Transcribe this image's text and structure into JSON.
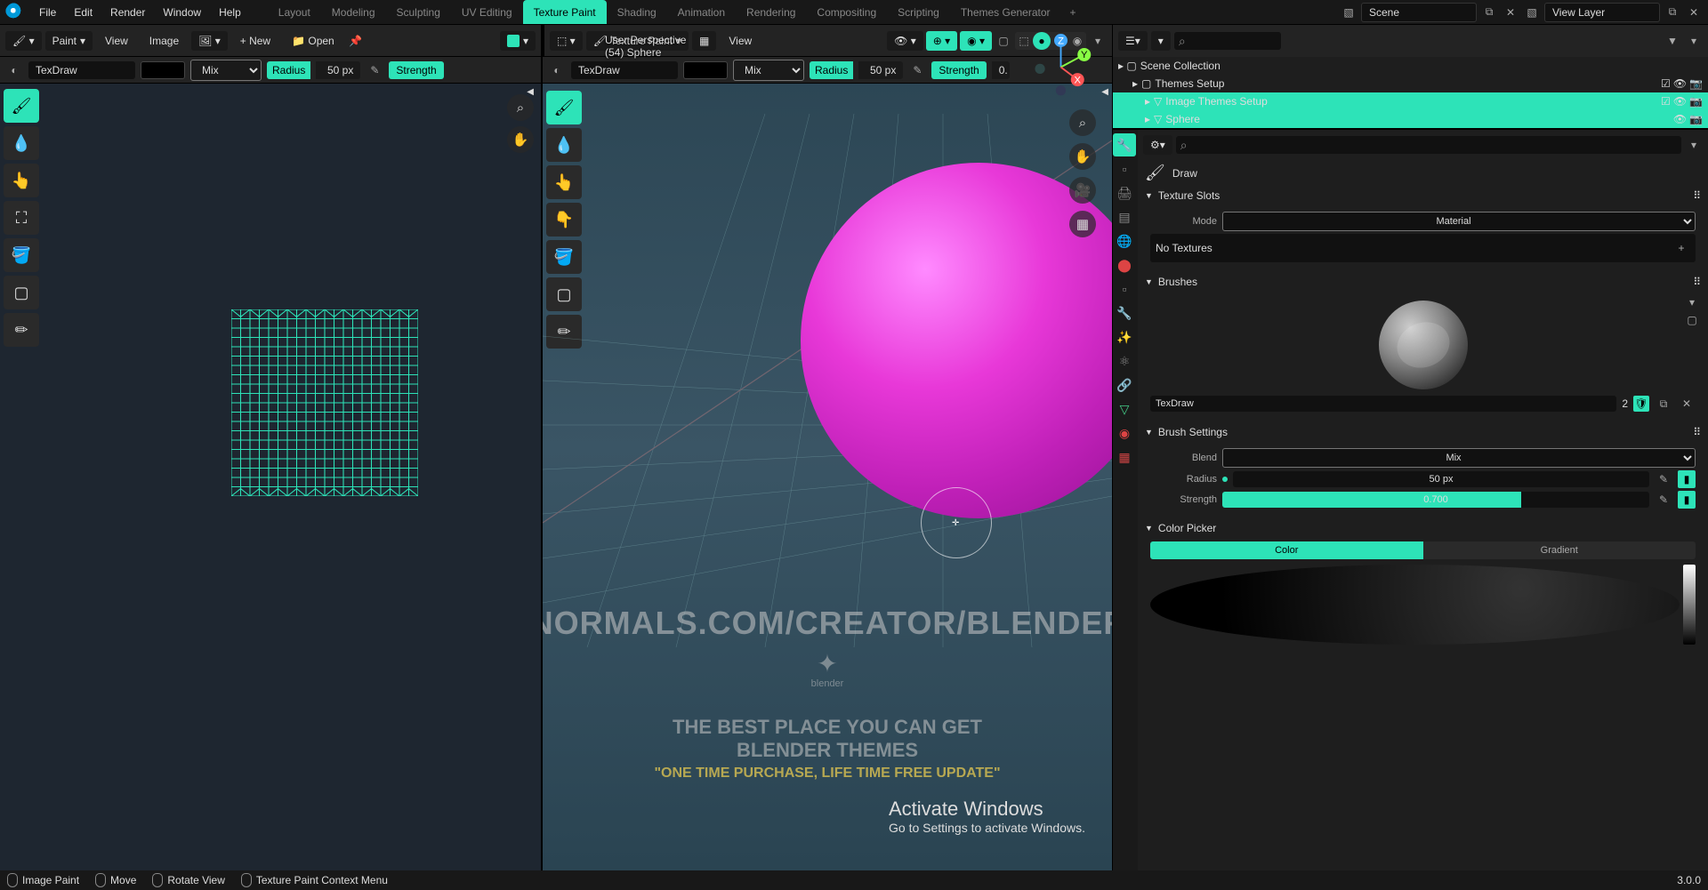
{
  "topmenu": {
    "file": "File",
    "edit": "Edit",
    "render": "Render",
    "window": "Window",
    "help": "Help"
  },
  "workspaces": [
    "Layout",
    "Modeling",
    "Sculpting",
    "UV Editing",
    "Texture Paint",
    "Shading",
    "Animation",
    "Rendering",
    "Compositing",
    "Scripting",
    "Themes Generator"
  ],
  "workspace_active": "Texture Paint",
  "scene": {
    "label": "Scene",
    "layer": "View Layer"
  },
  "image_editor": {
    "mode": "Paint",
    "view": "View",
    "image": "Image",
    "new": "New",
    "open": "Open",
    "tex": "TexDraw",
    "blend": "Mix",
    "radius_label": "Radius",
    "radius": "50 px",
    "strength_label": "Strength"
  },
  "viewport": {
    "mode": "Texture Paint",
    "view": "View",
    "tex": "TexDraw",
    "blend": "Mix",
    "radius_label": "Radius",
    "radius": "50 px",
    "strength_label": "Strength",
    "strength_val": "0.",
    "persp": "User Perspective",
    "object": "(54) Sphere"
  },
  "watermark": {
    "url": "FLIPPEDNORMALS.COM/CREATOR/BLENDERTHEMES",
    "l1": "THE BEST PLACE YOU CAN GET",
    "l2": "BLENDER THEMES",
    "l3": "\"ONE TIME PURCHASE, LIFE TIME FREE UPDATE\"",
    "logo": "blender"
  },
  "activate": {
    "t": "Activate Windows",
    "s": "Go to Settings to activate Windows."
  },
  "outliner": {
    "collection": "Scene Collection",
    "rows": [
      {
        "name": "Themes Setup",
        "sel": false,
        "indent": 1
      },
      {
        "name": "Image Themes Setup",
        "sel": true,
        "indent": 2
      },
      {
        "name": "Sphere",
        "sel": true,
        "indent": 2
      }
    ]
  },
  "props": {
    "tool": "Draw",
    "texture_slots": {
      "title": "Texture Slots",
      "mode_label": "Mode",
      "mode": "Material",
      "empty": "No Textures"
    },
    "brushes": {
      "title": "Brushes",
      "name": "TexDraw",
      "count": "2"
    },
    "brush_settings": {
      "title": "Brush Settings",
      "blend_label": "Blend",
      "blend": "Mix",
      "radius_label": "Radius",
      "radius": "50 px",
      "strength_label": "Strength",
      "strength": "0.700"
    },
    "color_picker": {
      "title": "Color Picker",
      "color": "Color",
      "gradient": "Gradient"
    }
  },
  "status": {
    "mode": "Image Paint",
    "move": "Move",
    "rotate": "Rotate View",
    "menu": "Texture Paint Context Menu",
    "version": "3.0.0"
  }
}
